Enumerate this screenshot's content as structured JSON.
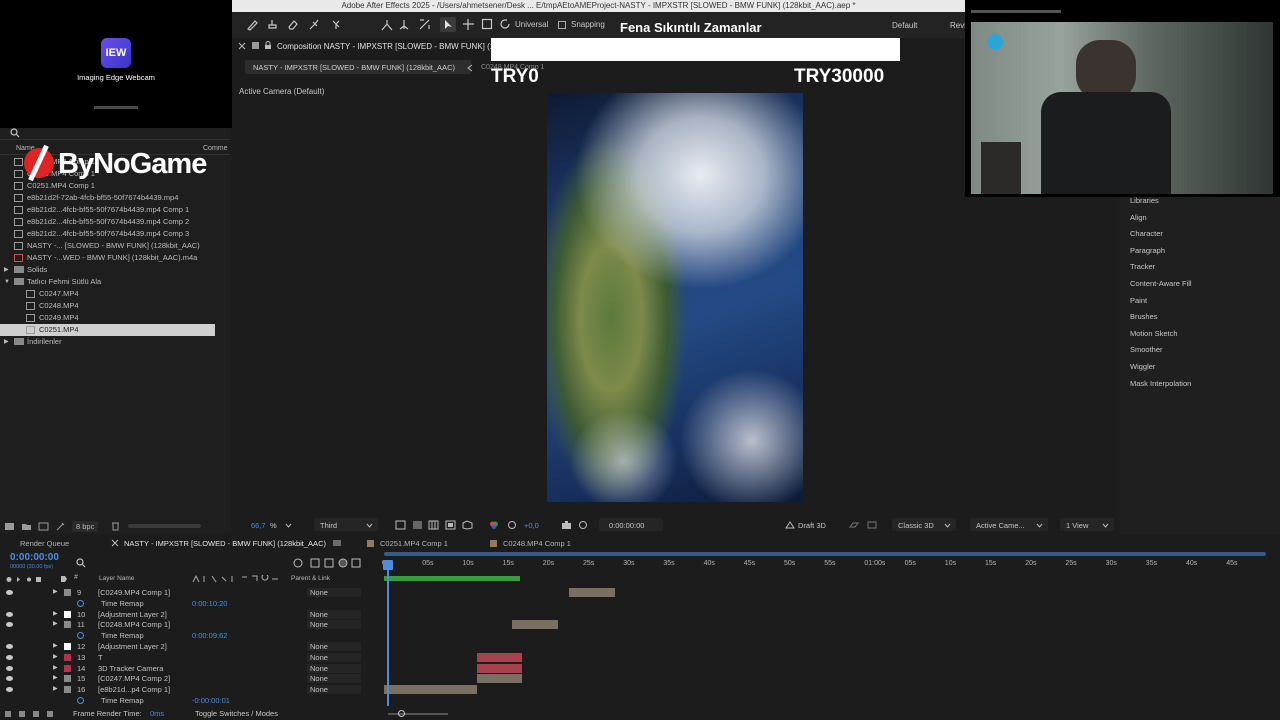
{
  "window": {
    "title": "Adobe After Effects 2025 - /Users/ahmetsener/Desk ... E/tmpAEtoAMEProject-NASTY - IMPXSTR [SLOWED - BMW FUNK] (128kbit_AAC).aep *"
  },
  "toolbar": {
    "universal_label": "Universal",
    "snapping_label": "Snapping",
    "workspace": "Default",
    "review_label": "Revi"
  },
  "webcam": {
    "logo_text": "IEW",
    "app_name": "Imaging Edge Webcam"
  },
  "overlay": {
    "logo_text": "ByNoGame",
    "song_title": "Fena Sıkıntılı Zamanlar",
    "donation_current": "TRY0",
    "donation_goal": "TRY30000"
  },
  "composition": {
    "tab_label": "Composition NASTY - IMPXSTR [SLOWED - BMW FUNK] (128",
    "breadcrumb_active": "NASTY - IMPXSTR [SLOWED - BMW FUNK] (128kbit_AAC)",
    "breadcrumb_next": "C0248.MP4 Comp 1",
    "camera_label": "Active Camera (Default)",
    "zoom": "66,7",
    "zoom_unit": "%",
    "resolution": "Third",
    "exposure": "+0,0",
    "timecode": "0:00:00:00",
    "renderer": "Draft 3D",
    "renderer_mode": "Classic 3D",
    "camera_select": "Active Came...",
    "view_select": "1 View"
  },
  "project": {
    "col_name": "Name",
    "col_comment": "Comme",
    "bpc": "8 bpc",
    "items": [
      {
        "label": "C0248.MP4 Comp 1",
        "indent": 0,
        "type": "comp"
      },
      {
        "label": "C0249.MP4 Comp 1",
        "indent": 0,
        "type": "comp"
      },
      {
        "label": "C0251.MP4 Comp 1",
        "indent": 0,
        "type": "comp"
      },
      {
        "label": "e8b21d2f-72ab-4fcb-bf55-50f7674b4439.mp4",
        "indent": 0,
        "type": "file"
      },
      {
        "label": "e8b21d2...4fcb-bf55-50f7674b4439.mp4 Comp 1",
        "indent": 0,
        "type": "comp"
      },
      {
        "label": "e8b21d2...4fcb-bf55-50f7674b4439.mp4 Comp 2",
        "indent": 0,
        "type": "comp"
      },
      {
        "label": "e8b21d2...4fcb-bf55-50f7674b4439.mp4 Comp 3",
        "indent": 0,
        "type": "comp"
      },
      {
        "label": "NASTY -... [SLOWED - BMW FUNK] (128kbit_AAC)",
        "indent": 0,
        "type": "comp"
      },
      {
        "label": "NASTY -...WED - BMW FUNK] (128kbit_AAC).m4a",
        "indent": 0,
        "type": "audio"
      },
      {
        "label": "Solids",
        "indent": 0,
        "type": "folder-closed"
      },
      {
        "label": "Tatlıcı Fehmi Sütlü Ala",
        "indent": 0,
        "type": "folder-open"
      },
      {
        "label": "C0247.MP4",
        "indent": 1,
        "type": "file"
      },
      {
        "label": "C0248.MP4",
        "indent": 1,
        "type": "file"
      },
      {
        "label": "C0249.MP4",
        "indent": 1,
        "type": "file"
      },
      {
        "label": "C0251.MP4",
        "indent": 1,
        "type": "file",
        "selected": true
      },
      {
        "label": "İndirilenler",
        "indent": 0,
        "type": "folder-closed"
      }
    ]
  },
  "panels": {
    "items": [
      "Libraries",
      "Align",
      "Character",
      "Paragraph",
      "Tracker",
      "Content-Aware Fill",
      "Paint",
      "Brushes",
      "Motion Sketch",
      "Smoother",
      "Wiggler",
      "Mask Interpolation"
    ]
  },
  "timeline": {
    "tabs": [
      "Render Queue",
      "NASTY - IMPXSTR [SLOWED - BMW FUNK] (128kbit_AAC)",
      "C0251.MP4 Comp 1",
      "C0248.MP4 Comp 1"
    ],
    "timecode": "0:00:00:00",
    "timecode_sub": "00000 (30.00 fps)",
    "col_layer_name": "Layer Name",
    "col_parent": "Parent & Link",
    "ruler": [
      "0s",
      "05s",
      "10s",
      "15s",
      "20s",
      "25s",
      "30s",
      "35s",
      "40s",
      "45s",
      "50s",
      "55s",
      "01:00s",
      "05s",
      "10s",
      "15s",
      "20s",
      "25s",
      "30s",
      "35s",
      "40s",
      "45s"
    ],
    "layers": [
      {
        "num": "9",
        "name": "[C0249.MP4 Comp 1]",
        "parent": "None",
        "color": "#8a8a8a",
        "kind": "layer",
        "bar_start": 0.21,
        "bar_len": 0.052
      },
      {
        "num": "",
        "name": "Time Remap",
        "value": "0:00:10:20",
        "kind": "prop"
      },
      {
        "num": "10",
        "name": "[Adjustment Layer 2]",
        "parent": "None",
        "color": "#ffffff",
        "kind": "layer",
        "bar_start": 0,
        "bar_len": 0
      },
      {
        "num": "11",
        "name": "[C0248.MP4 Comp 1]",
        "parent": "None",
        "color": "#8a8a8a",
        "kind": "layer",
        "bar_start": 0.145,
        "bar_len": 0.052
      },
      {
        "num": "",
        "name": "Time Remap",
        "value": "0:00:09:62",
        "kind": "prop"
      },
      {
        "num": "12",
        "name": "[Adjustment Layer 2]",
        "parent": "None",
        "color": "#ffffff",
        "kind": "layer",
        "bar_start": 0,
        "bar_len": 0
      },
      {
        "num": "13",
        "name": "T",
        "parent": "None",
        "color": "#b5334a",
        "kind": "layer",
        "bar_start": 0.105,
        "bar_len": 0.052
      },
      {
        "num": "14",
        "name": "3D Tracker Camera",
        "parent": "None",
        "color": "#b5334a",
        "kind": "layer",
        "bar_start": 0.105,
        "bar_len": 0.052
      },
      {
        "num": "15",
        "name": "[C0247.MP4 Comp 2]",
        "parent": "None",
        "color": "#8a8a8a",
        "kind": "layer",
        "bar_start": 0.105,
        "bar_len": 0.052
      },
      {
        "num": "16",
        "name": "[e8b21d...p4 Comp 1]",
        "parent": "None",
        "color": "#8a8a8a",
        "kind": "layer",
        "bar_start": 0.0,
        "bar_len": 0.105
      },
      {
        "num": "",
        "name": "Time Remap",
        "value": "-0:00:00:01",
        "kind": "prop"
      }
    ],
    "render_time_label": "Frame Render Time:",
    "render_time_value": "0ms",
    "toggle_label": "Toggle Switches / Modes"
  }
}
